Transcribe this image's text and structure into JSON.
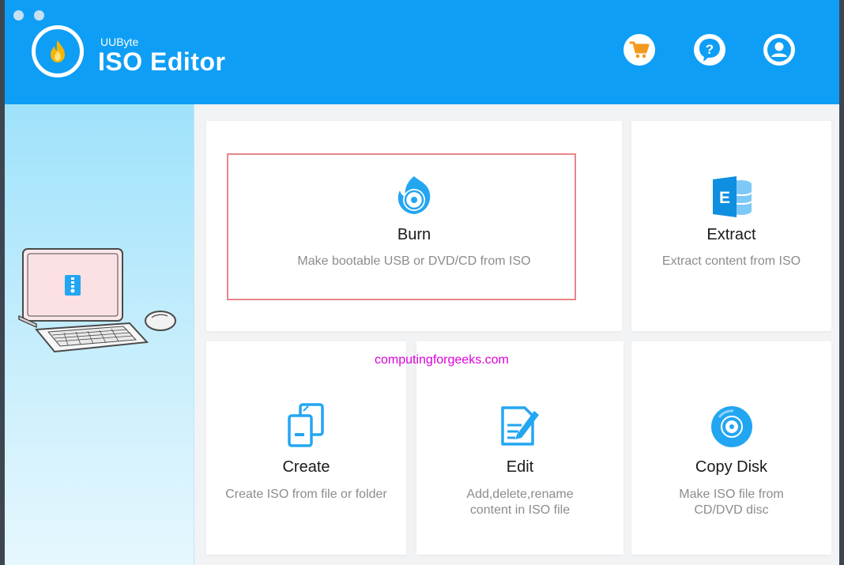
{
  "app": {
    "brand_small": "UUByte",
    "brand_name": "ISO Editor"
  },
  "header": {
    "buttons": [
      {
        "name": "cart-button",
        "icon": "cart-icon"
      },
      {
        "name": "help-button",
        "icon": "question-icon"
      },
      {
        "name": "account-button",
        "icon": "user-icon"
      }
    ]
  },
  "features": {
    "burn": {
      "title": "Burn",
      "desc": "Make bootable USB or DVD/CD from ISO",
      "icon": "burn-disc-icon"
    },
    "extract": {
      "title": "Extract",
      "desc": "Extract content from ISO",
      "icon": "extract-database-icon"
    },
    "create": {
      "title": "Create",
      "desc": "Create ISO from file or folder",
      "icon": "create-files-icon"
    },
    "edit": {
      "title": "Edit",
      "desc_line1": "Add,delete,rename",
      "desc_line2": "content in ISO file",
      "icon": "edit-pencil-icon"
    },
    "copy": {
      "title": "Copy Disk",
      "desc_line1": "Make ISO file from",
      "desc_line2": "CD/DVD disc",
      "icon": "copy-disk-icon"
    }
  },
  "watermark": "computingforgeeks.com",
  "colors": {
    "accent": "#0f9ef5",
    "highlight": "#e8868a",
    "watermark": "#d900d9",
    "cart": "#f39a1e"
  }
}
